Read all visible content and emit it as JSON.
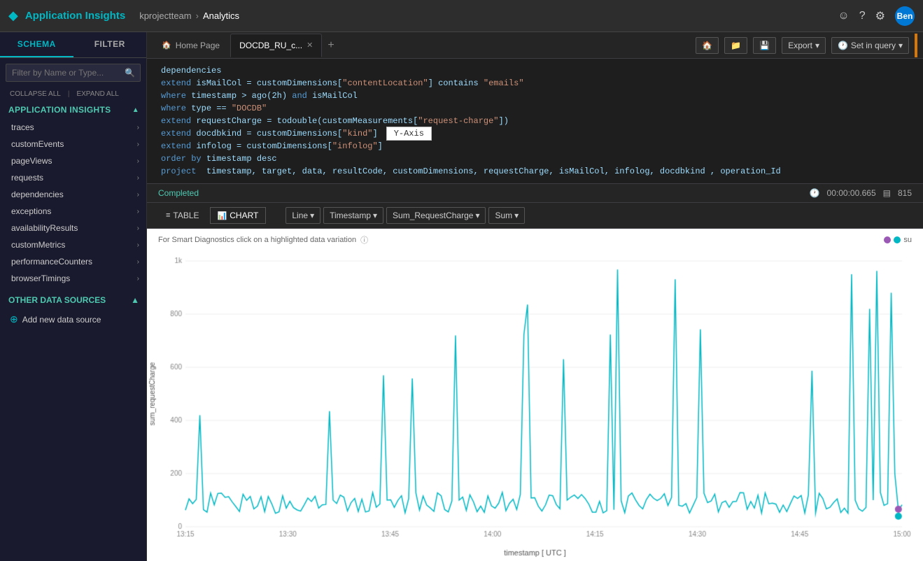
{
  "topNav": {
    "appIcon": "◆",
    "appTitle": "Application Insights",
    "breadcrumb": {
      "team": "kprojectteam",
      "arrow": "›",
      "page": "Analytics"
    },
    "icons": {
      "smiley": "☺",
      "help": "?",
      "settings": "⚙"
    },
    "avatar": "Ben"
  },
  "sidebar": {
    "tabs": [
      {
        "id": "schema",
        "label": "SCHEMA",
        "active": true
      },
      {
        "id": "filter",
        "label": "FILTER",
        "active": false
      }
    ],
    "searchPlaceholder": "Filter by Name or Type...",
    "collapseAll": "COLLAPSE ALL",
    "expandAll": "EXPAND ALL",
    "sectionTitle": "APPLICATION INSIGHTS",
    "items": [
      {
        "label": "traces"
      },
      {
        "label": "customEvents"
      },
      {
        "label": "pageViews"
      },
      {
        "label": "requests"
      },
      {
        "label": "dependencies"
      },
      {
        "label": "exceptions"
      },
      {
        "label": "availabilityResults"
      },
      {
        "label": "customMetrics"
      },
      {
        "label": "performanceCounters"
      },
      {
        "label": "browserTimings"
      }
    ],
    "otherSources": "OTHER DATA SOURCES",
    "addDataSource": "Add new data source"
  },
  "tabs": [
    {
      "id": "home",
      "label": "Home Page",
      "icon": "🏠",
      "closeable": false,
      "active": false
    },
    {
      "id": "docdb",
      "label": "DOCDB_RU_c...",
      "icon": "",
      "closeable": true,
      "active": true
    }
  ],
  "toolbar": {
    "exportLabel": "Export",
    "setInQueryLabel": "Set in query"
  },
  "codeEditor": {
    "lines": [
      {
        "text": "dependencies",
        "type": "plain"
      },
      {
        "text": "extend isMailCol = customDimensions[\"contentLocation\"] contains \"emails\"",
        "type": "mixed"
      },
      {
        "text": "where timestamp > ago(2h) and isMailCol",
        "type": "mixed"
      },
      {
        "text": "where type == \"DOCDB\"",
        "type": "mixed"
      },
      {
        "text": "extend requestCharge = todouble(customMeasurements[\"request-charge\"])",
        "type": "mixed"
      },
      {
        "text": "extend docdbkind = customDimensions[\"kind\"]",
        "type": "mixed"
      },
      {
        "text": "extend infolog = customDimensions[\"infolog\"",
        "type": "mixed"
      },
      {
        "text": "order by timestamp desc",
        "type": "mixed"
      },
      {
        "text": "project  timestamp, target, data, resultCode, customDimensions, requestCharge, isMailCol, infolog, docdbkind , operation_Id",
        "type": "mixed"
      }
    ],
    "yAxisTooltip": "Y-Axis"
  },
  "results": {
    "status": "Completed",
    "duration": "00:00:00.665",
    "rows": "815"
  },
  "chartToolbar": {
    "tableLabel": "TABLE",
    "chartLabel": "CHART",
    "lineLabel": "Line",
    "timestampLabel": "Timestamp",
    "sumRequestChargeLabel": "Sum_RequestCharge",
    "sumLabel": "Sum"
  },
  "chart": {
    "hint": "For Smart Diagnostics click on a highlighted data variation",
    "yAxisLabel": "sum_requestCharge",
    "xAxisLabel": "timestamp [ UTC ]",
    "yTicks": [
      "1k",
      "800",
      "600",
      "400",
      "200",
      "0"
    ],
    "xTicks": [
      "13:15",
      "13:30",
      "13:45",
      "14:00",
      "14:15",
      "14:30",
      "14:45",
      "15:00"
    ],
    "legend": "su",
    "legendColor": "#00b7c3",
    "accentColor": "#00b7c3"
  }
}
